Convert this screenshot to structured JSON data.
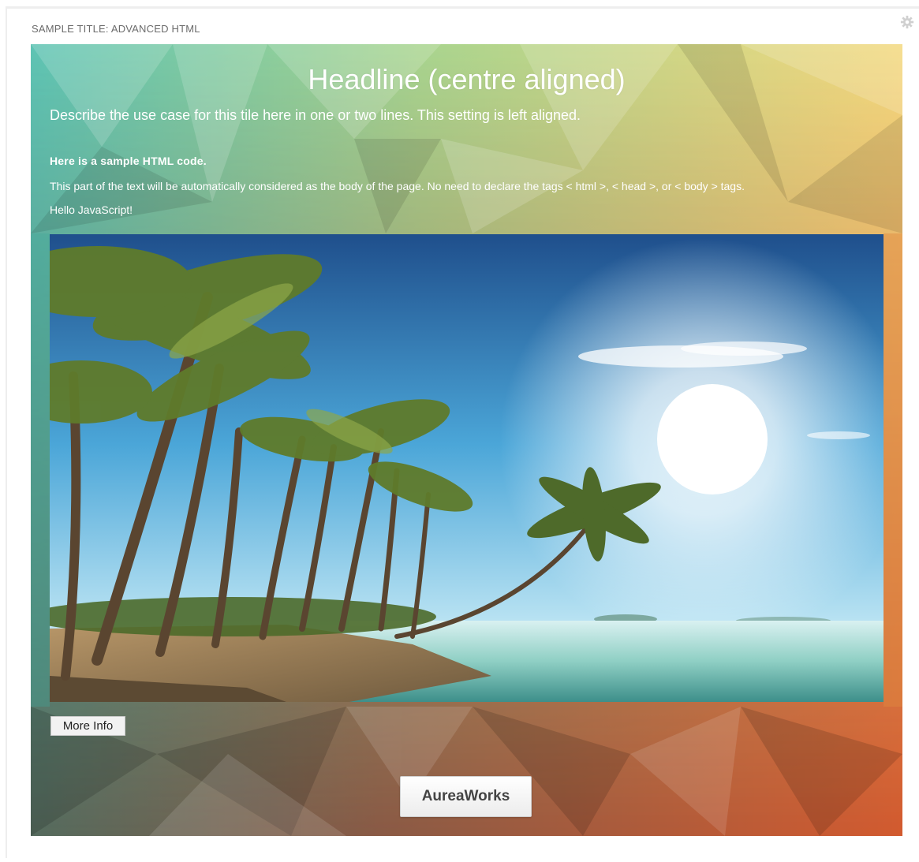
{
  "tile": {
    "title": "SAMPLE TITLE: ADVANCED HTML",
    "settings_icon": "gear-icon"
  },
  "content": {
    "headline": "Headline (centre aligned)",
    "description": "Describe the use case for this tile here in one or two lines. This setting is left aligned.",
    "sample_heading": "Here is a sample HTML code.",
    "body_note": "This part of the text will be automatically considered as the body of the page. No need to declare the tags < html >, < head >, or < body > tags.",
    "hello": "Hello JavaScript!",
    "image_description_icon": "tropical-beach-image",
    "more_info_label": "More Info",
    "brand_button_label": "AureaWorks"
  },
  "colors": {
    "gradient_top_left": "#5dc3b5",
    "gradient_top_right": "#f6dc84",
    "gradient_bottom_left": "#4f5f56",
    "gradient_bottom_right": "#d4542c"
  }
}
